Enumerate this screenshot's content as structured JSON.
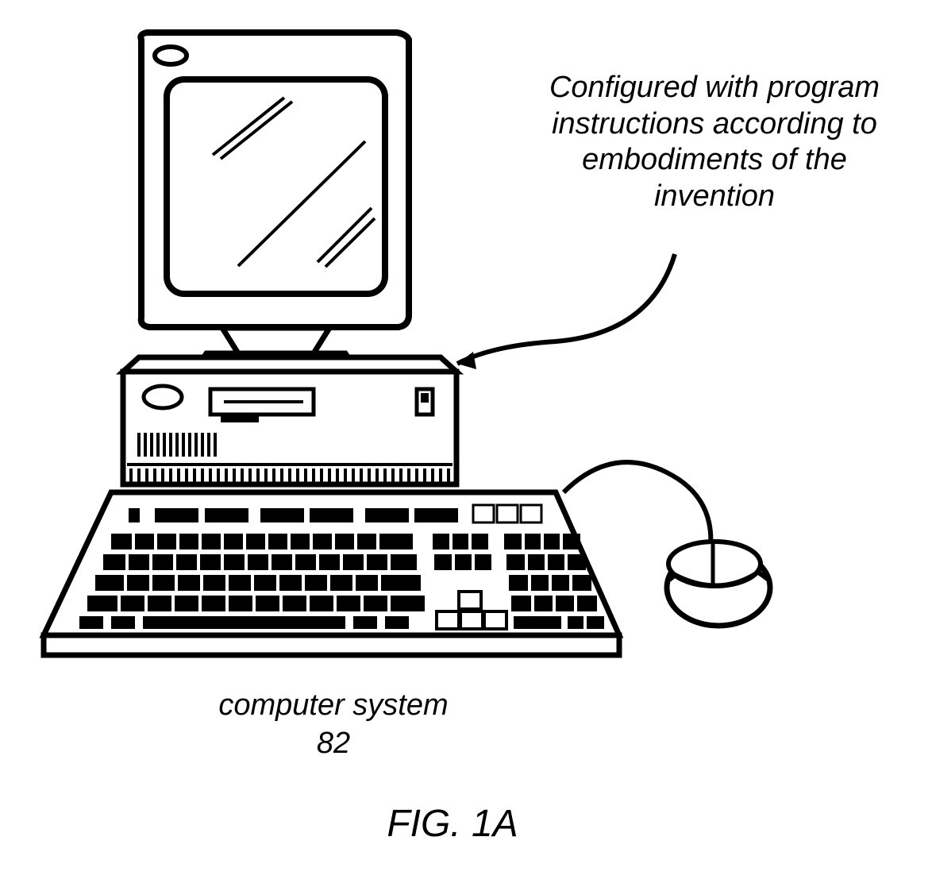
{
  "callout_text": "Configured with program instructions according to embodiments of the invention",
  "label": {
    "name": "computer system",
    "ref_num": "82"
  },
  "figure_caption": "FIG. 1A"
}
